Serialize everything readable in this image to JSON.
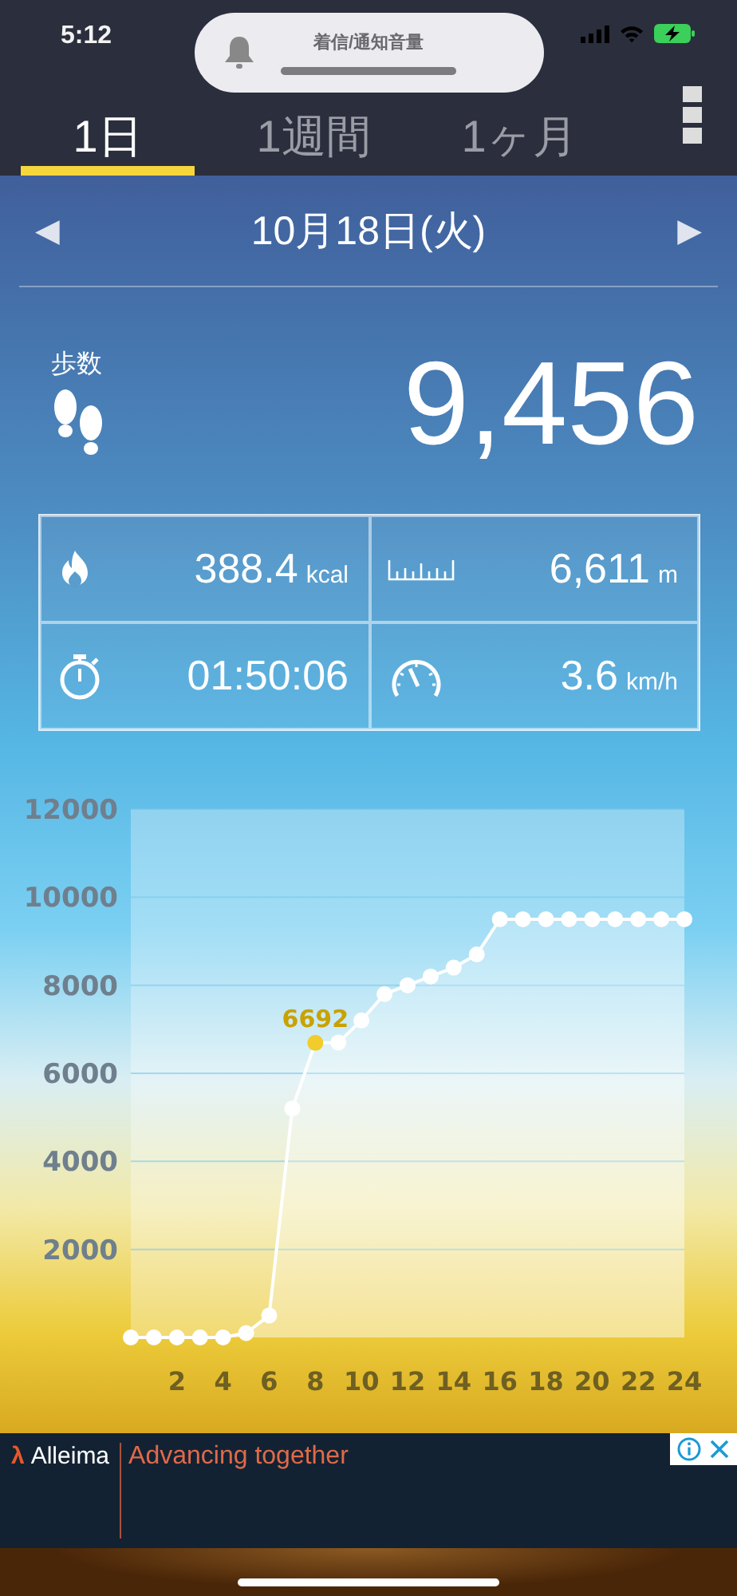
{
  "status_bar": {
    "time": "5:12"
  },
  "volume_hud": {
    "title": "着信/通知音量",
    "level": 1
  },
  "tabs": [
    {
      "label": "1日",
      "selected": true
    },
    {
      "label": "1週間",
      "selected": false
    },
    {
      "label": "1ヶ月",
      "selected": false
    }
  ],
  "date_nav": {
    "prev": "◀",
    "date": "10月18日(火)",
    "next": "▶"
  },
  "steps": {
    "label": "歩数",
    "value": "9,456"
  },
  "stats": [
    {
      "kind": "calories",
      "value": "388.4",
      "unit": "kcal"
    },
    {
      "kind": "distance",
      "value": "6,611",
      "unit": "m"
    },
    {
      "kind": "time",
      "value": "01:50:06"
    },
    {
      "kind": "speed",
      "value": "3.6",
      "unit": "km/h"
    }
  ],
  "chart": {
    "chart_data": {
      "type": "area",
      "x": [
        0,
        1,
        2,
        3,
        4,
        5,
        6,
        7,
        8,
        9,
        10,
        11,
        12,
        13,
        14,
        15,
        16,
        17,
        18,
        19,
        20,
        21,
        22,
        23,
        24
      ],
      "series": [
        {
          "color": "#ffffff",
          "values": [
            0,
            0,
            0,
            0,
            0,
            100,
            500,
            5200,
            6692,
            6700,
            7200,
            7800,
            8000,
            8200,
            8400,
            8700,
            9500,
            9500,
            9500,
            9500,
            9500,
            9500,
            9500,
            9500,
            9500
          ]
        }
      ],
      "grid": true,
      "xlim": [
        0,
        24
      ],
      "ylim": [
        0,
        12000
      ],
      "xticks": [
        2,
        4,
        6,
        8,
        10,
        12,
        14,
        16,
        18,
        20,
        22,
        24
      ],
      "yticks": [
        2000,
        4000,
        6000,
        8000,
        10000,
        12000
      ],
      "annotations": [
        {
          "x": 8,
          "y": 6692,
          "text": "6692"
        }
      ]
    }
  },
  "ad": {
    "brand": "Alleima",
    "brand_mark": "λ",
    "tagline": "Advancing together"
  }
}
